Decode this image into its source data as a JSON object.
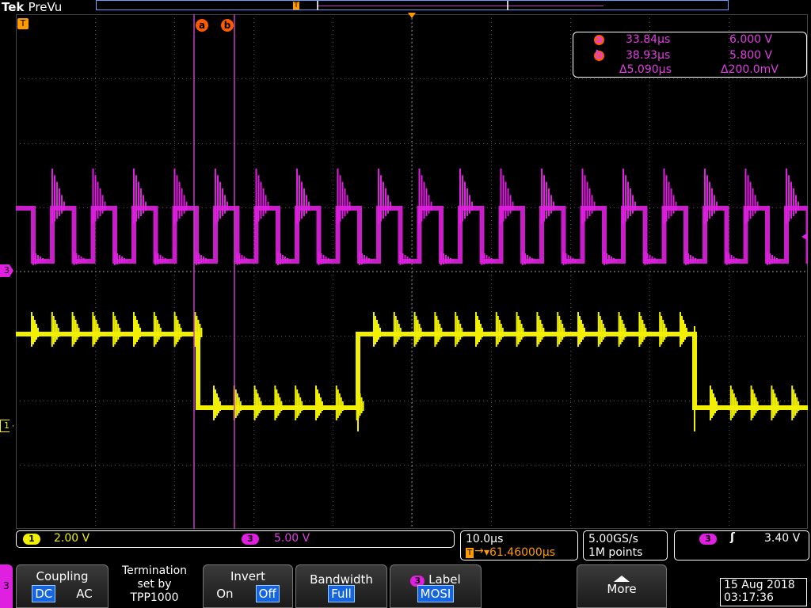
{
  "brand": {
    "tek": "Tek",
    "mode": "PreVu"
  },
  "cursors": {
    "a_label": "a",
    "b_label": "b",
    "a_time": "33.84µs",
    "a_volt": "6.000 V",
    "b_time": "38.93µs",
    "b_volt": "5.800 V",
    "delta_time": "Δ5.090µs",
    "delta_volt": "Δ200.0mV"
  },
  "markers": {
    "trigger": "T",
    "ch3": "3",
    "ch1": "1"
  },
  "status": {
    "ch1_num": "1",
    "ch1_scale": "2.00 V",
    "ch3_num": "3",
    "ch3_scale": "5.00 V",
    "timebase": "10.0µs",
    "trigger_delay": "▾61.46000µs",
    "sample_rate": "5.00GS/s",
    "record_length": "1M points",
    "trig_source": "3",
    "trig_level": "3.40 V"
  },
  "menu": {
    "channel": "3",
    "coupling_label": "Coupling",
    "coupling_dc": "DC",
    "coupling_ac": "AC",
    "termination_line1": "Termination",
    "termination_line2": "set by",
    "termination_line3": "TPP1000",
    "invert_label": "Invert",
    "invert_on": "On",
    "invert_off": "Off",
    "bandwidth_label": "Bandwidth",
    "bandwidth_value": "Full",
    "label_ch": "3",
    "label_title": "Label",
    "label_value": "MOSI",
    "more_label": "More"
  },
  "datetime": {
    "date": "15 Aug 2018",
    "time": "03:17:36"
  },
  "colors": {
    "ch1": "#f0f000",
    "ch3": "#e020e0",
    "cursor": "#ff5a00",
    "accent": "#1565e0"
  }
}
